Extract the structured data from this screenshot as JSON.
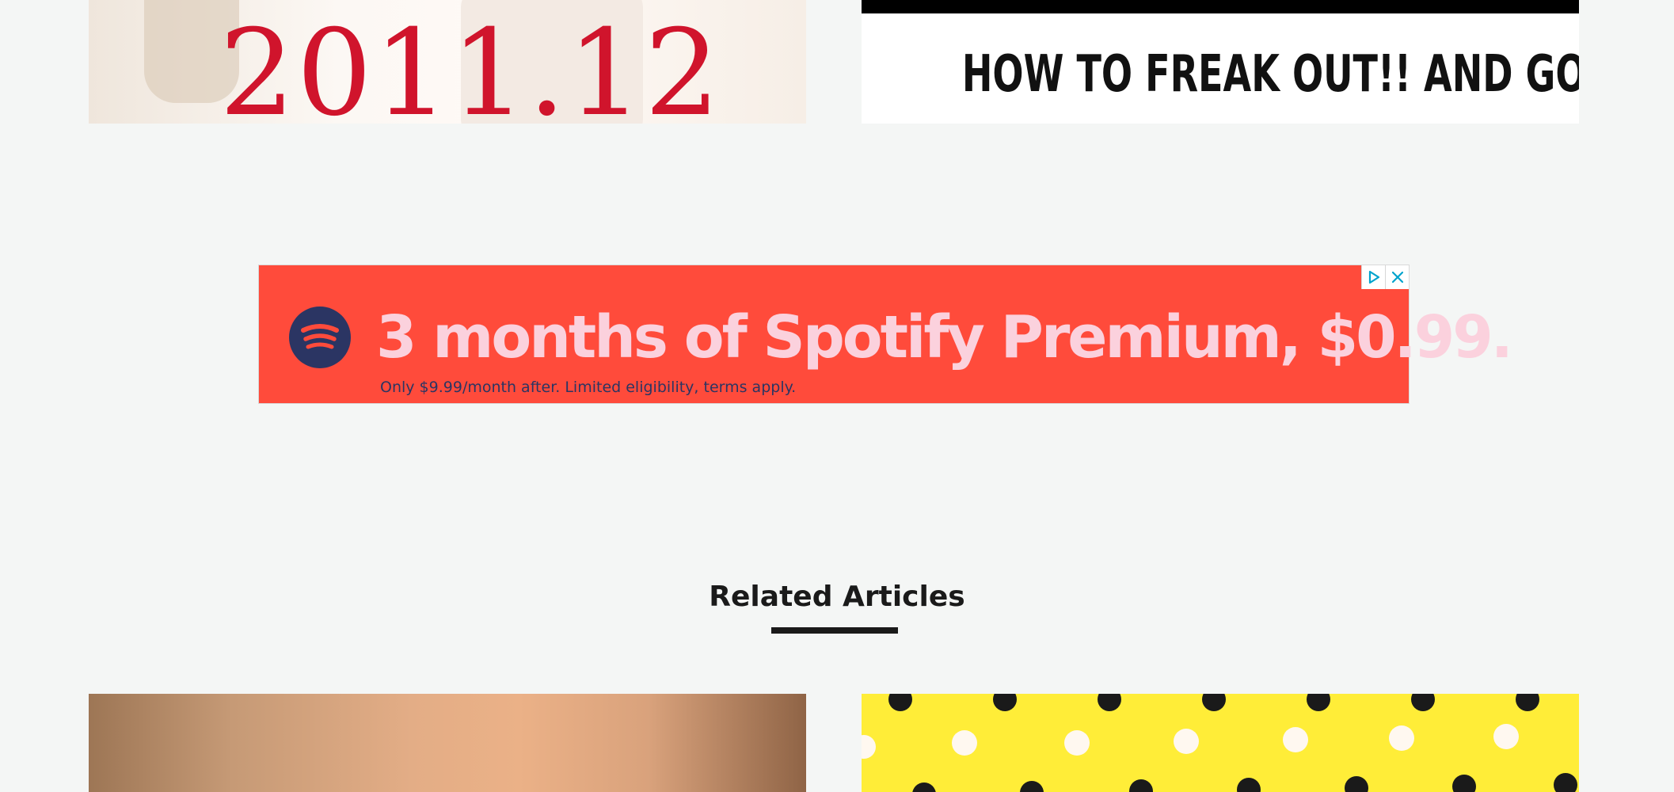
{
  "top_cards": {
    "left": {
      "image_text": "2011.12",
      "date_color": "#d0142c"
    },
    "right": {
      "image_text": "HOW TO FREAK OUT!! AND GO CRAZY!!"
    }
  },
  "ad": {
    "headline": "3 months of Spotify Premium, $0.99.",
    "subtext": "Only $9.99/month after. Limited eligibility, terms apply.",
    "background_color": "#ff4b3b",
    "headline_color": "#fbd1dd",
    "logo_icon": "spotify-logo-icon",
    "adchoices_icon": "adchoices-icon",
    "close_icon": "close-icon"
  },
  "related": {
    "title": "Related Articles"
  },
  "bottom_cards": {
    "left": {
      "image": "skin-tone-gradient"
    },
    "right": {
      "image": "yellow-polka-dot-pattern",
      "background_color": "#ffed38"
    }
  }
}
